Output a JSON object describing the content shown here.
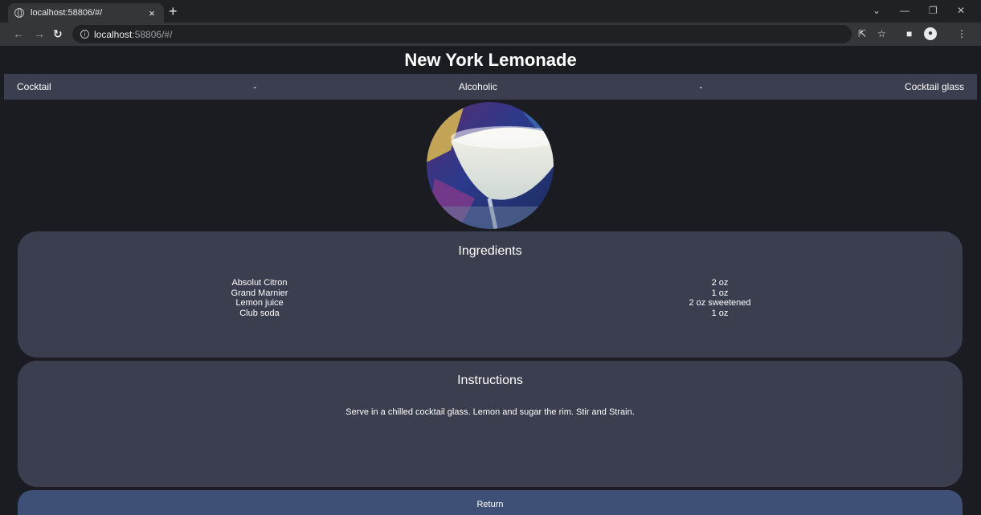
{
  "browser": {
    "tab_title": "localhost:58806/#/",
    "tab_close": "×",
    "new_tab": "+",
    "url_host": "localhost",
    "url_rest": ":58806/#/"
  },
  "drink": {
    "name": "New York Lemonade",
    "category": "Cocktail",
    "separator": "-",
    "alcoholic": "Alcoholic",
    "glass": "Cocktail glass",
    "image_alt": "New York Lemonade"
  },
  "ingredients": {
    "heading": "Ingredients",
    "items": [
      {
        "name": "Absolut Citron",
        "measure": "2 oz"
      },
      {
        "name": "Grand Marnier",
        "measure": "1 oz"
      },
      {
        "name": "Lemon juice",
        "measure": "2 oz sweetened"
      },
      {
        "name": "Club soda",
        "measure": "1 oz"
      }
    ]
  },
  "instructions": {
    "heading": "Instructions",
    "text": "Serve in a chilled cocktail glass. Lemon and sugar the rim. Stir and Strain."
  },
  "actions": {
    "return_label": "Return"
  },
  "icons": {
    "tab_site": "globe-icon",
    "back": "back-arrow-icon",
    "forward": "forward-arrow-icon",
    "reload": "reload-icon",
    "site_info": "info-icon",
    "share": "share-icon",
    "bookmark": "star-icon",
    "side_panel": "side-panel-icon",
    "profile": "profile-icon",
    "menu": "kebab-menu-icon"
  },
  "colors": {
    "page_bg": "#1a1c22",
    "card_bg": "#3a3e4f",
    "return_bg": "#3f5076"
  }
}
